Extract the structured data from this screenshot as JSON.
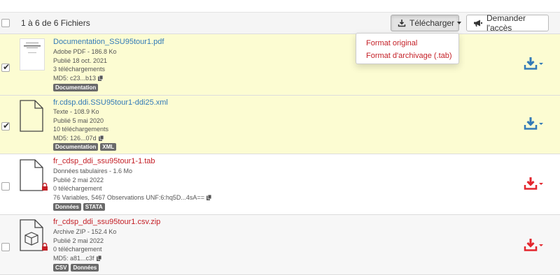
{
  "header": {
    "count_text": "1 à 6 de 6 Fichiers",
    "download_button": "Télécharger",
    "request_button": "Demander l'accès"
  },
  "download_menu": {
    "options": [
      "Format original",
      "Format d'archivage (.tab)"
    ]
  },
  "files": [
    {
      "name": "Documentation_SSU95tour1.pdf",
      "type_size": "Adobe PDF - 186.8 Ko",
      "published": "Publié 18 oct. 2021",
      "downloads": "3 téléchargements",
      "md5": "MD5: c23...b13",
      "tags": [
        "Documentation"
      ],
      "checked": true,
      "restricted": false
    },
    {
      "name": "fr.cdsp.ddi.SSU95tour1-ddi25.xml",
      "type_size": "Texte - 108.9 Ko",
      "published": "Publié 5 mai 2020",
      "downloads": "10 téléchargements",
      "md5": "MD5: 126...07d",
      "tags": [
        "Documentation",
        "XML"
      ],
      "checked": true,
      "restricted": false
    },
    {
      "name": "fr_cdsp_ddi_ssu95tour1-1.tab",
      "type_size": "Données tabulaires - 1.6 Mo",
      "published": "Publié 2 mai 2022",
      "downloads": "0 téléchargement",
      "md5": "76 Variables, 5467 Observations UNF:6:hq5D...4sA==",
      "tags": [
        "Données",
        "STATA"
      ],
      "checked": false,
      "restricted": true
    },
    {
      "name": "fr_cdsp_ddi_ssu95tour1.csv.zip",
      "type_size": "Archive ZIP - 152.4 Ko",
      "published": "Publié 2 mai 2022",
      "downloads": "0 téléchargement",
      "md5": "MD5: a81...c3f",
      "tags": [
        "CSV",
        "Données"
      ],
      "checked": false,
      "restricted": true
    }
  ],
  "colors": {
    "selected_row": "#fcfcd2",
    "link_blue": "#337ab7",
    "restricted_red": "#c42027",
    "tag_grey": "#6a6a6a"
  }
}
